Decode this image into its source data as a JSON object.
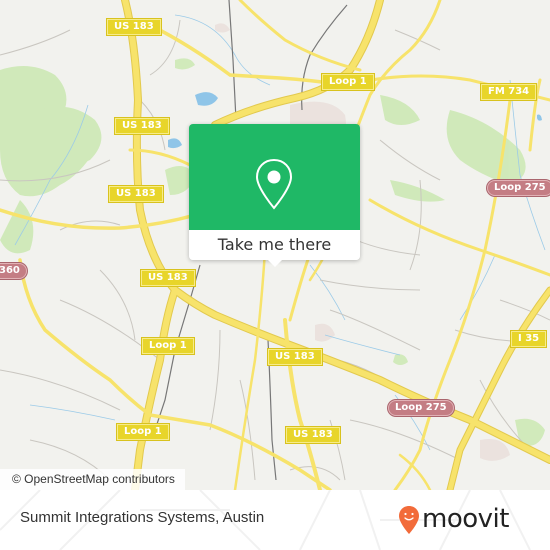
{
  "map": {
    "colors": {
      "background": "#f2f2ee",
      "major_road": "#f7e36b",
      "major_road_casing": "#e2c94d",
      "minor_road": "#c9c6c0",
      "water": "#8fc5e8",
      "park": "#cde9b5",
      "railway": "#777777",
      "urban": "#e8ddd9"
    },
    "shields": [
      {
        "label": "US 183",
        "style": "yellow"
      },
      {
        "label": "US 183",
        "style": "yellow"
      },
      {
        "label": "US 183",
        "style": "yellow"
      },
      {
        "label": "US 183",
        "style": "yellow"
      },
      {
        "label": "US 183",
        "style": "yellow"
      },
      {
        "label": "US 183",
        "style": "yellow"
      },
      {
        "label": "Loop 1",
        "style": "yellow"
      },
      {
        "label": "Loop 1",
        "style": "yellow"
      },
      {
        "label": "Loop 1",
        "style": "yellow"
      },
      {
        "label": "FM 734",
        "style": "yellow"
      },
      {
        "label": "I 35",
        "style": "yellow"
      },
      {
        "label": "Loop 275",
        "style": "red"
      },
      {
        "label": "Loop 275",
        "style": "red"
      },
      {
        "label": "360",
        "style": "red"
      }
    ],
    "attribution": "© OpenStreetMap contributors"
  },
  "popup": {
    "icon": "map-pin-icon",
    "button_label": "Take me there",
    "color": "#1fb866"
  },
  "footer": {
    "place_name": "Summit Integrations Systems, Austin",
    "logo_text": "moovit",
    "logo_icon": "moovit-smiley-pin-icon",
    "logo_color": "#f26b3a"
  }
}
